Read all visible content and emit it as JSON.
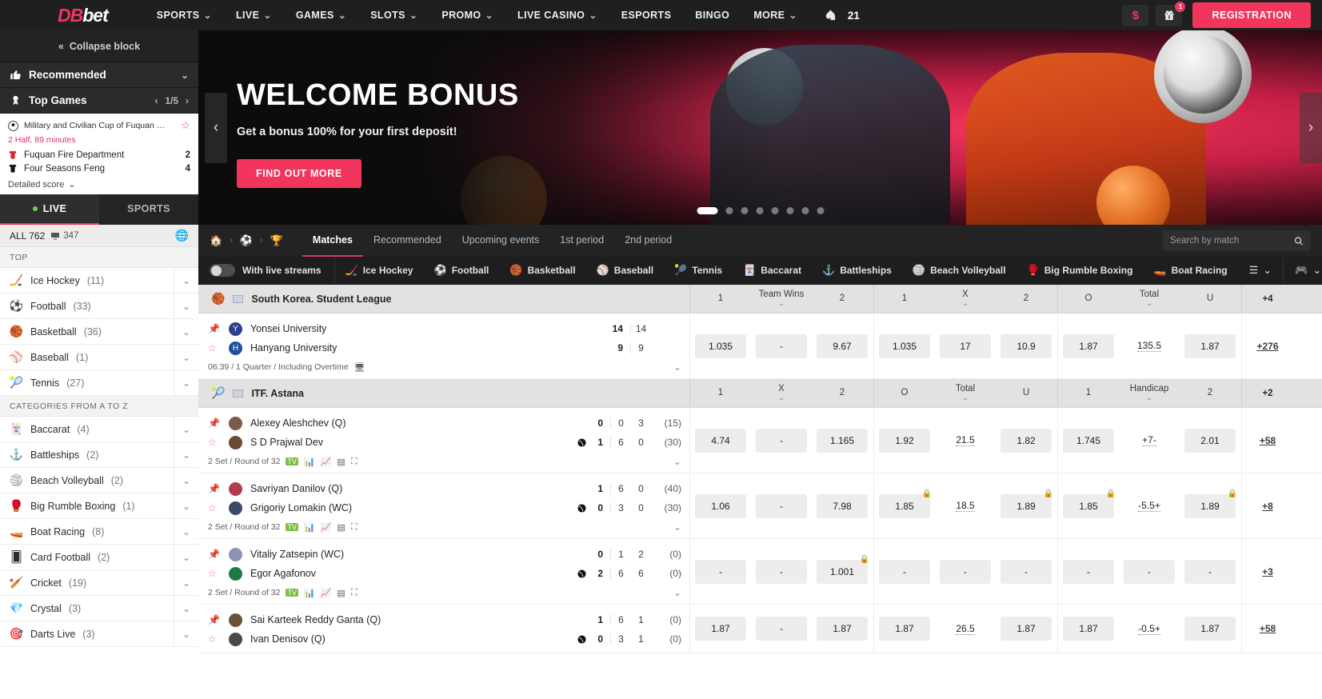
{
  "header": {
    "logo": {
      "part1": "DB",
      "part2": "bet"
    },
    "nav": [
      {
        "label": "SPORTS",
        "caret": true
      },
      {
        "label": "LIVE",
        "caret": true
      },
      {
        "label": "GAMES",
        "caret": true
      },
      {
        "label": "SLOTS",
        "caret": true
      },
      {
        "label": "PROMO",
        "caret": true
      },
      {
        "label": "LIVE CASINO",
        "caret": true
      },
      {
        "label": "ESPORTS",
        "caret": false
      },
      {
        "label": "BINGO",
        "caret": false
      },
      {
        "label": "MORE",
        "caret": true
      }
    ],
    "spade_count": "21",
    "gift_badge": "1",
    "registration_label": "REGISTRATION",
    "accent": "#f2355d"
  },
  "sidebar": {
    "collapse_label": "Collapse block",
    "recommended": {
      "label": "Recommended"
    },
    "top_games": {
      "label": "Top Games",
      "pager": "1/5"
    },
    "top_game_card": {
      "title": "Military and Civilian Cup of Fuquan …",
      "time": "2 Half, 89 minutes",
      "home_team": "Fuquan Fire Department",
      "home_score": "2",
      "away_team": "Four Seasons Feng",
      "away_score": "4",
      "detailed_label": "Detailed score"
    },
    "tabs": [
      {
        "label": "LIVE",
        "active": true
      },
      {
        "label": "SPORTS",
        "active": false
      }
    ],
    "all_row": {
      "label": "ALL 762",
      "stream_count": "347"
    },
    "groups": [
      {
        "title": "TOP",
        "items": [
          {
            "label": "Ice Hockey",
            "count": "(11)",
            "icon": "ice-hockey-icon"
          },
          {
            "label": "Football",
            "count": "(33)",
            "icon": "football-icon"
          },
          {
            "label": "Basketball",
            "count": "(36)",
            "icon": "basketball-icon"
          },
          {
            "label": "Baseball",
            "count": "(1)",
            "icon": "baseball-icon"
          },
          {
            "label": "Tennis",
            "count": "(27)",
            "icon": "tennis-icon"
          }
        ]
      },
      {
        "title": "CATEGORIES FROM A TO Z",
        "items": [
          {
            "label": "Baccarat",
            "count": "(4)",
            "icon": "baccarat-icon"
          },
          {
            "label": "Battleships",
            "count": "(2)",
            "icon": "battleships-icon"
          },
          {
            "label": "Beach Volleyball",
            "count": "(2)",
            "icon": "beach-volleyball-icon"
          },
          {
            "label": "Big Rumble Boxing",
            "count": "(1)",
            "icon": "boxing-icon"
          },
          {
            "label": "Boat Racing",
            "count": "(8)",
            "icon": "boat-racing-icon"
          },
          {
            "label": "Card Football",
            "count": "(2)",
            "icon": "card-football-icon"
          },
          {
            "label": "Cricket",
            "count": "(19)",
            "icon": "cricket-icon"
          },
          {
            "label": "Crystal",
            "count": "(3)",
            "icon": "crystal-icon"
          },
          {
            "label": "Darts Live",
            "count": "(3)",
            "icon": "darts-icon"
          }
        ]
      }
    ]
  },
  "banner": {
    "title": "WELCOME BONUS",
    "subtitle": "Get a bonus 100% for your first deposit!",
    "button": "FIND OUT MORE",
    "dots": 8,
    "active_dot": 0
  },
  "content": {
    "tabs": [
      {
        "label": "Matches",
        "active": true
      },
      {
        "label": "Recommended",
        "active": false
      },
      {
        "label": "Upcoming events",
        "active": false
      },
      {
        "label": "1st period",
        "active": false
      },
      {
        "label": "2nd period",
        "active": false
      }
    ],
    "search_placeholder": "Search by match",
    "live_stream_toggle": "With live streams",
    "sport_chips": [
      {
        "label": "Ice Hockey",
        "icon": "ice-hockey-icon"
      },
      {
        "label": "Football",
        "icon": "football-icon"
      },
      {
        "label": "Basketball",
        "icon": "basketball-icon"
      },
      {
        "label": "Baseball",
        "icon": "baseball-icon"
      },
      {
        "label": "Tennis",
        "icon": "tennis-icon"
      },
      {
        "label": "Baccarat",
        "icon": "baccarat-icon"
      },
      {
        "label": "Battleships",
        "icon": "battleships-icon"
      },
      {
        "label": "Beach Volleyball",
        "icon": "beach-volleyball-icon"
      },
      {
        "label": "Big Rumble Boxing",
        "icon": "boxing-icon"
      },
      {
        "label": "Boat Racing",
        "icon": "boat-racing-icon"
      }
    ]
  },
  "leagues": [
    {
      "name": "South Korea. Student League",
      "sport_icon": "basketball-icon",
      "flag": "kr-flag-icon",
      "market_groups": [
        {
          "cols": [
            {
              "label": "1"
            },
            {
              "label": "Team Wins",
              "chev": true
            },
            {
              "label": "2"
            }
          ]
        },
        {
          "cols": [
            {
              "label": "1"
            },
            {
              "label": "X",
              "chev": true
            },
            {
              "label": "2"
            }
          ]
        },
        {
          "cols": [
            {
              "label": "O"
            },
            {
              "label": "Total",
              "chev": true
            },
            {
              "label": "U"
            }
          ]
        }
      ],
      "plus_label": "+4",
      "matches": [
        {
          "home": {
            "name": "Yonsei University",
            "logo_color": "#2b3f8c",
            "logo_glyph": "Y",
            "serving": false
          },
          "away": {
            "name": "Hanyang University",
            "logo_color": "#1d4f9e",
            "logo_glyph": "H",
            "serving": false
          },
          "home_main": "14",
          "away_main": "9",
          "home_cells": [
            "14"
          ],
          "away_cells": [
            "9"
          ],
          "home_point": "",
          "away_point": "",
          "meta": "06:39 / 1 Quarter / Including Overtime",
          "meta_icons": [
            "monitor-icon"
          ],
          "odds": [
            [
              {
                "v": "1.035"
              },
              {
                "v": "-"
              },
              {
                "v": "9.67"
              }
            ],
            [
              {
                "v": "1.035"
              },
              {
                "v": "17"
              },
              {
                "v": "10.9"
              }
            ],
            [
              {
                "v": "1.87"
              },
              {
                "v": "135.5",
                "plain": true
              },
              {
                "v": "1.87"
              }
            ]
          ],
          "plus": "+276"
        }
      ]
    },
    {
      "name": "ITF. Astana",
      "sport_icon": "tennis-icon",
      "flag": "kz-flag-icon",
      "market_groups": [
        {
          "cols": [
            {
              "label": "1"
            },
            {
              "label": "X",
              "chev": true
            },
            {
              "label": "2"
            }
          ]
        },
        {
          "cols": [
            {
              "label": "O"
            },
            {
              "label": "Total",
              "chev": true
            },
            {
              "label": "U"
            }
          ]
        },
        {
          "cols": [
            {
              "label": "1"
            },
            {
              "label": "Handicap",
              "chev": true
            },
            {
              "label": "2"
            }
          ]
        }
      ],
      "plus_label": "+2",
      "matches": [
        {
          "home": {
            "name": "Alexey Aleshchev (Q)",
            "logo_color": "#7a5b46",
            "logo_glyph": "",
            "serving": false
          },
          "away": {
            "name": "S D Prajwal Dev",
            "logo_color": "#6b4a34",
            "logo_glyph": "",
            "serving": true
          },
          "home_main": "0",
          "away_main": "1",
          "home_cells": [
            "0",
            "3"
          ],
          "away_cells": [
            "6",
            "0"
          ],
          "home_point": "(15)",
          "away_point": "(30)",
          "meta": "2 Set / Round of 32",
          "meta_icons": [
            "stream-icon",
            "stats-icon",
            "chart-icon",
            "list-icon",
            "court-icon"
          ],
          "odds": [
            [
              {
                "v": "4.74"
              },
              {
                "v": "-"
              },
              {
                "v": "1.165"
              }
            ],
            [
              {
                "v": "1.92"
              },
              {
                "v": "21.5",
                "plain": true
              },
              {
                "v": "1.82"
              }
            ],
            [
              {
                "v": "1.745"
              },
              {
                "v": "+7-",
                "plain": true
              },
              {
                "v": "2.01"
              }
            ]
          ],
          "plus": "+58"
        },
        {
          "home": {
            "name": "Savriyan Danilov (Q)",
            "logo_color": "#b23b4e",
            "logo_glyph": "",
            "serving": false
          },
          "away": {
            "name": "Grigoriy Lomakin (WC)",
            "logo_color": "#3a4a6b",
            "logo_glyph": "",
            "serving": true
          },
          "home_main": "1",
          "away_main": "0",
          "home_cells": [
            "6",
            "0"
          ],
          "away_cells": [
            "3",
            "0"
          ],
          "home_point": "(40)",
          "away_point": "(30)",
          "meta": "2 Set / Round of 32",
          "meta_icons": [
            "stream-icon",
            "stats-icon",
            "chart-icon",
            "list-icon",
            "court-icon"
          ],
          "odds": [
            [
              {
                "v": "1.06"
              },
              {
                "v": "-"
              },
              {
                "v": "7.98"
              }
            ],
            [
              {
                "v": "1.85",
                "lock": true
              },
              {
                "v": "18.5",
                "plain": true
              },
              {
                "v": "1.89",
                "lock": true
              }
            ],
            [
              {
                "v": "1.85",
                "lock": true
              },
              {
                "v": "-5.5+",
                "plain": true
              },
              {
                "v": "1.89",
                "lock": true
              }
            ]
          ],
          "plus": "+8"
        },
        {
          "home": {
            "name": "Vitaliy Zatsepin (WC)",
            "logo_color": "#8d93b5",
            "logo_glyph": "",
            "serving": false
          },
          "away": {
            "name": "Egor Agafonov",
            "logo_color": "#1e7a44",
            "logo_glyph": "",
            "serving": true
          },
          "home_main": "0",
          "away_main": "2",
          "home_cells": [
            "1",
            "2"
          ],
          "away_cells": [
            "6",
            "6"
          ],
          "home_point": "(0)",
          "away_point": "(0)",
          "meta": "2 Set / Round of 32",
          "meta_icons": [
            "stream-icon",
            "stats-icon",
            "chart-icon",
            "list-icon",
            "court-icon"
          ],
          "odds": [
            [
              {
                "v": "-"
              },
              {
                "v": "-"
              },
              {
                "v": "1.001",
                "lock": true
              }
            ],
            [
              {
                "v": "-"
              },
              {
                "v": "-"
              },
              {
                "v": "-"
              }
            ],
            [
              {
                "v": "-"
              },
              {
                "v": "-"
              },
              {
                "v": "-"
              }
            ]
          ],
          "plus": "+3"
        },
        {
          "home": {
            "name": "Sai Karteek Reddy Ganta (Q)",
            "logo_color": "#6b5138",
            "logo_glyph": "",
            "serving": false
          },
          "away": {
            "name": "Ivan Denisov (Q)",
            "logo_color": "#4a4a4a",
            "logo_glyph": "",
            "serving": true
          },
          "home_main": "1",
          "away_main": "0",
          "home_cells": [
            "6",
            "1"
          ],
          "away_cells": [
            "3",
            "1"
          ],
          "home_point": "(0)",
          "away_point": "(0)",
          "meta": "",
          "meta_icons": [],
          "odds": [
            [
              {
                "v": "1.87"
              },
              {
                "v": "-"
              },
              {
                "v": "1.87"
              }
            ],
            [
              {
                "v": "1.87"
              },
              {
                "v": "26.5",
                "plain": true
              },
              {
                "v": "1.87"
              }
            ],
            [
              {
                "v": "1.87"
              },
              {
                "v": "-0.5+",
                "plain": true
              },
              {
                "v": "1.87"
              }
            ]
          ],
          "plus": "+58"
        }
      ]
    }
  ]
}
